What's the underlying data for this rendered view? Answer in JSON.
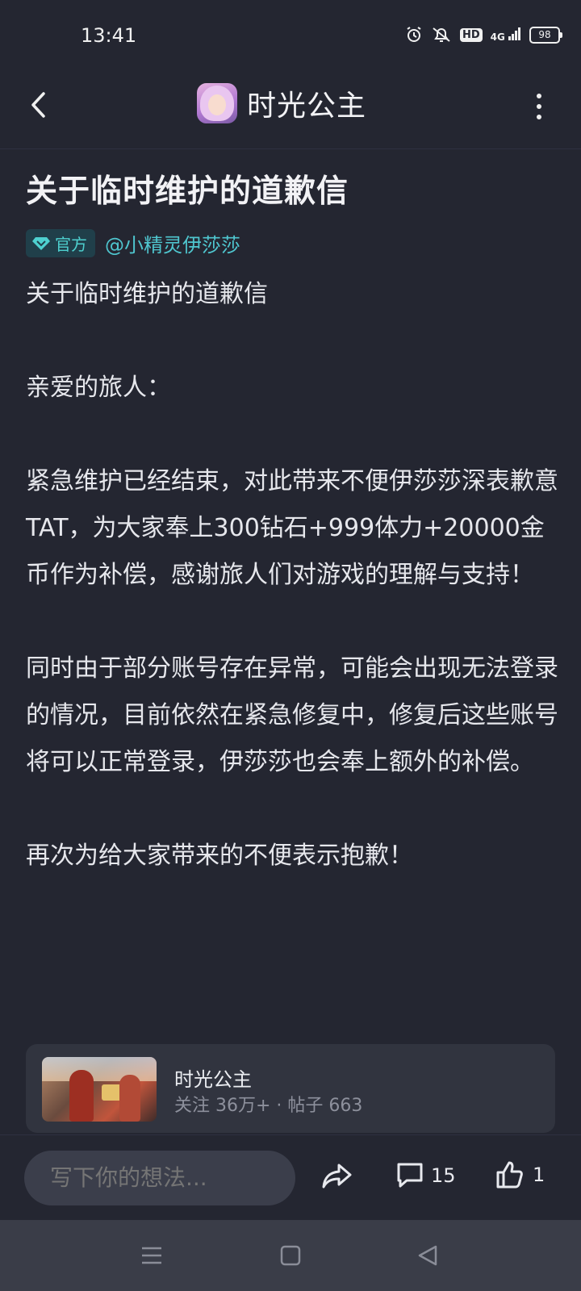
{
  "status_bar": {
    "time": "13:41",
    "icons": [
      "alarm-icon",
      "mute-icon",
      "hd-icon",
      "signal-4g-icon",
      "battery-icon"
    ],
    "hd_label": "HD",
    "network_label": "4G",
    "battery_level": "98"
  },
  "header": {
    "back_icon": "chevron-left-icon",
    "app_icon": "princess-avatar-icon",
    "title": "时光公主",
    "more_icon": "more-vertical-icon"
  },
  "post": {
    "title": "关于临时维护的道歉信",
    "badge_label": "官方",
    "badge_icon": "diamond-icon",
    "author": "@小精灵伊莎莎",
    "paragraphs": [
      "关于临时维护的道歉信",
      "亲爱的旅人：",
      "紧急维护已经结束，对此带来不便伊莎莎深表歉意TAT，为大家奉上300钻石+999体力+20000金币作为补偿，感谢旅人们对游戏的理解与支持！",
      "同时由于部分账号存在异常，可能会出现无法登录的情况，目前依然在紧急修复中，修复后这些账号将可以正常登录，伊莎莎也会奉上额外的补偿。",
      "再次为给大家带来的不便表示抱歉！"
    ]
  },
  "forum_card": {
    "name": "时光公主",
    "stats": "关注 36万+ · 帖子 663"
  },
  "bottom_bar": {
    "comment_placeholder": "写下你的想法...",
    "share_icon": "share-icon",
    "comment_icon": "comment-icon",
    "comment_count": "15",
    "like_icon": "thumbs-up-icon",
    "like_count": "1"
  },
  "nav_bar": {
    "icons": [
      "menu-icon",
      "home-square-icon",
      "back-triangle-icon"
    ]
  },
  "colors": {
    "background": "#242631",
    "accent": "#4fc6cf",
    "card": "#31343f",
    "input": "#3b3e4b"
  }
}
